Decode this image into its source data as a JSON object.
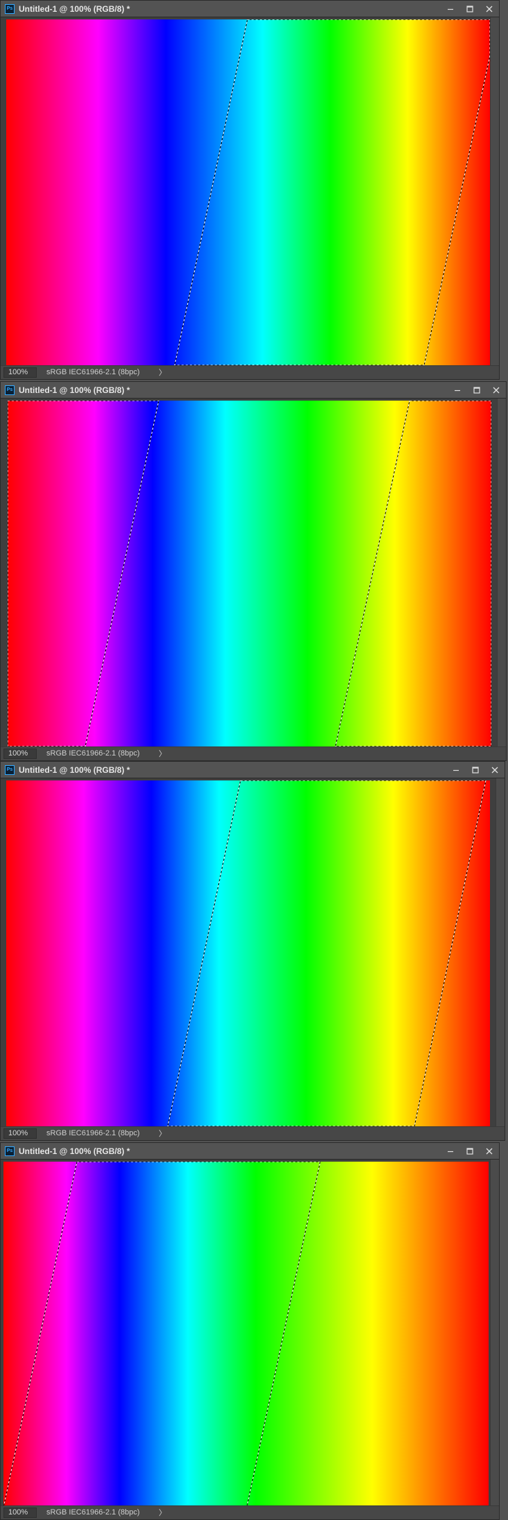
{
  "app": {
    "logo_text": "Ps",
    "colors": {
      "frame": "#535353",
      "titlebar": "#535353",
      "accent": "#31a8ff",
      "selection": "#ffffff"
    }
  },
  "windows": [
    {
      "title": "Untitled-1 @ 100% (RGB/8) *",
      "zoom": "100%",
      "doc_info": "sRGB IEC61966-2.1 (8bpc)",
      "status_chevron": "〉",
      "icons": [
        "photoshop-icon",
        "minimize-icon",
        "maximize-icon",
        "close-icon"
      ]
    },
    {
      "title": "Untitled-1 @ 100% (RGB/8) *",
      "zoom": "100%",
      "doc_info": "sRGB IEC61966-2.1 (8bpc)",
      "status_chevron": "〉",
      "icons": [
        "photoshop-icon",
        "minimize-icon",
        "maximize-icon",
        "close-icon"
      ]
    },
    {
      "title": "Untitled-1 @ 100% (RGB/8) *",
      "zoom": "100%",
      "doc_info": "sRGB IEC61966-2.1 (8bpc)",
      "status_chevron": "〉",
      "icons": [
        "photoshop-icon",
        "minimize-icon",
        "maximize-icon",
        "close-icon"
      ]
    },
    {
      "title": "Untitled-1 @ 100% (RGB/8) *",
      "zoom": "100%",
      "doc_info": "sRGB IEC61966-2.1 (8bpc)",
      "status_chevron": "〉",
      "icons": [
        "photoshop-icon",
        "minimize-icon",
        "maximize-icon",
        "close-icon"
      ]
    }
  ]
}
